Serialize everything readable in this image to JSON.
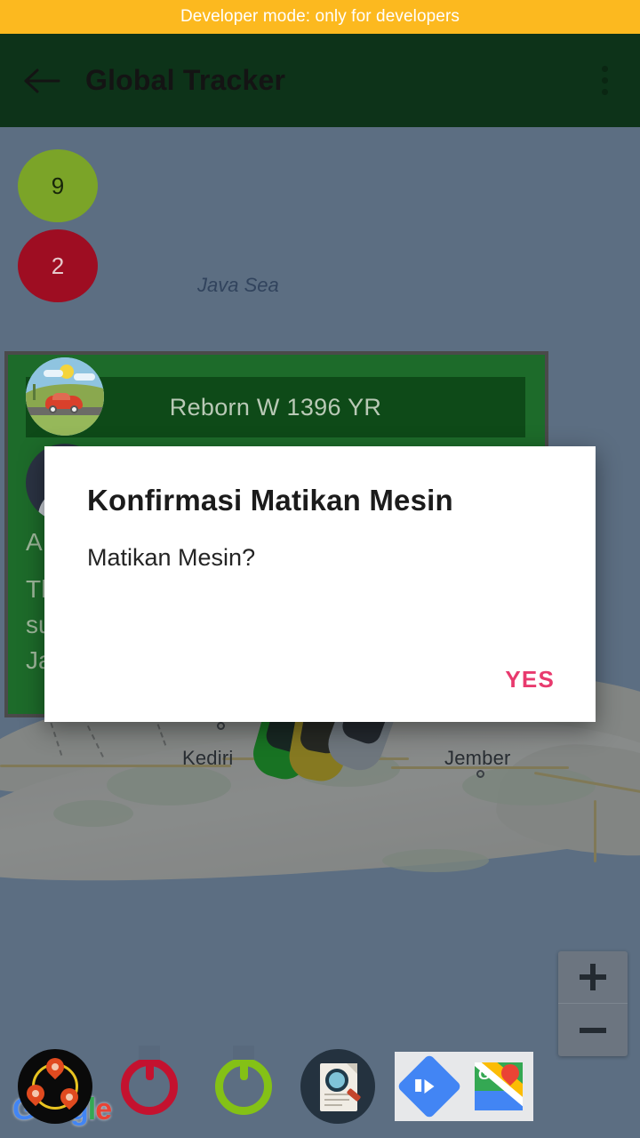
{
  "dev_banner": {
    "text": "Developer mode: only for developers",
    "bg_color": "#fcb91f"
  },
  "app_bar": {
    "title": "Global Tracker",
    "bg_color": "#0d3319",
    "back_icon": "arrow-left-icon",
    "menu_icon": "overflow-menu-icon"
  },
  "map": {
    "sea_label": "Java Sea",
    "city_labels": [
      "Kediri",
      "Jember"
    ],
    "attribution": "Google",
    "clusters": [
      {
        "count": "9",
        "color": "#7ba428",
        "text_color": "#17250a"
      },
      {
        "count": "2",
        "color": "#9e0d22",
        "text_color": "#e6c9cc"
      }
    ],
    "vehicle_markers": [
      {
        "name": "car-marker-green",
        "color": "#1db81d"
      },
      {
        "name": "car-marker-yellow",
        "color": "#e3c319"
      },
      {
        "name": "car-marker-silver",
        "color": "#b9bdc0"
      }
    ],
    "zoom_in_label": "+",
    "zoom_out_label": "−"
  },
  "info_card": {
    "title": "Reborn W 1396 YR",
    "avatar_icon": "car-photo-avatar",
    "driver_avatar_icon": "person-avatar",
    "detail_lines": [
      "A",
      "Th",
      "su",
      "Ja"
    ]
  },
  "dialog": {
    "title": "Konfirmasi Matikan Mesin",
    "message": "Matikan Mesin?",
    "confirm_label": "YES",
    "confirm_color": "#e83a6e"
  },
  "toolbar": {
    "buttons": [
      {
        "name": "tracking-button",
        "icon": "map-pins-tracking-icon",
        "color": "#0a0a0a"
      },
      {
        "name": "engine-off-button",
        "icon": "power-icon",
        "color": "#c4122f"
      },
      {
        "name": "engine-on-button",
        "icon": "power-icon",
        "color": "#84c116"
      },
      {
        "name": "report-button",
        "icon": "document-search-icon",
        "color": "#24323f"
      },
      {
        "name": "directions-button",
        "icon": "directions-icon",
        "color": "#4285f4"
      },
      {
        "name": "google-maps-button",
        "icon": "google-maps-icon",
        "color": "#34a853"
      }
    ]
  }
}
